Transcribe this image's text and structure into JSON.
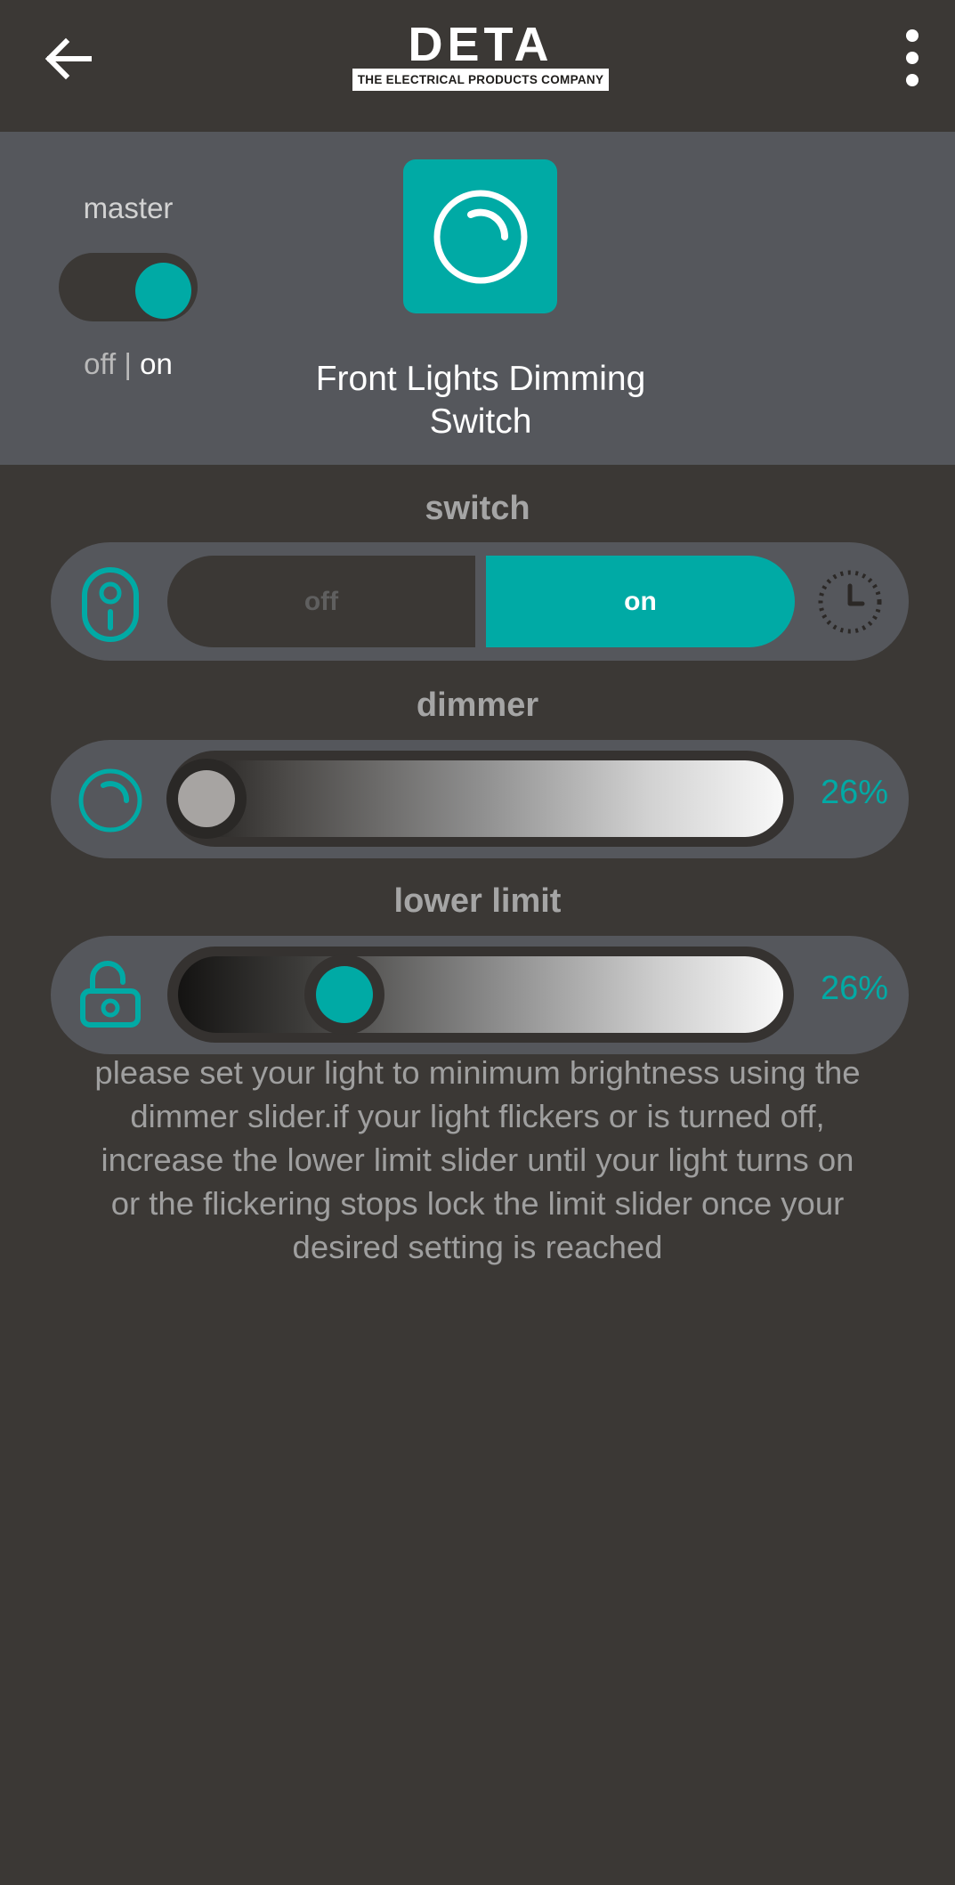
{
  "app": {
    "brand_name": "DETA",
    "brand_tagline": "THE ELECTRICAL PRODUCTS COMPANY"
  },
  "header": {
    "master_label": "master",
    "master_state_off": "off",
    "master_state_sep": " | ",
    "master_state_on": "on",
    "master_toggle_on": true,
    "device_title": "Front Lights Dimming Switch"
  },
  "switch": {
    "label": "switch",
    "off_label": "off",
    "on_label": "on",
    "selected": "on"
  },
  "dimmer": {
    "label": "dimmer",
    "value_text": "26%",
    "value": 0.05
  },
  "lower_limit": {
    "label": "lower limit",
    "value_text": "26%",
    "value": 0.26,
    "locked": false
  },
  "instructions": "please set your light to minimum brightness using the dimmer slider.if your light flickers or is turned off, increase the lower limit slider until your light turns on or the flickering stops lock the limit slider once your desired setting is reached",
  "colors": {
    "accent": "#00aaa5",
    "background": "#3b3835",
    "panel": "#55575c"
  },
  "icons": {
    "back": "arrow-left-icon",
    "menu": "more-vertical-icon",
    "device": "dimmer-knob-icon",
    "remote": "remote-switch-icon",
    "schedule": "clock-timer-icon",
    "dimmer": "dimmer-knob-icon",
    "lock": "unlock-icon"
  }
}
